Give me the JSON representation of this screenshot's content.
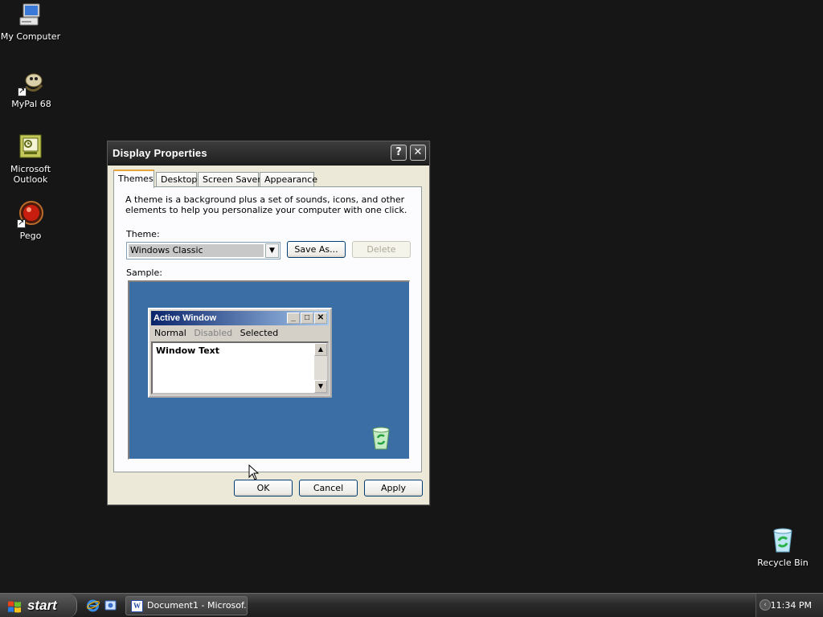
{
  "desktop": {
    "icons": [
      {
        "label": "My Computer"
      },
      {
        "label": "MyPal 68"
      },
      {
        "label": "Microsoft Outlook"
      },
      {
        "label": "Pego"
      },
      {
        "label": "Recycle Bin"
      }
    ]
  },
  "dialog": {
    "title": "Display Properties",
    "help_label": "?",
    "close_label": "✕",
    "tabs": [
      {
        "label": "Themes",
        "active": true
      },
      {
        "label": "Desktop"
      },
      {
        "label": "Screen Saver"
      },
      {
        "label": "Appearance"
      }
    ],
    "description": "A theme is a background plus a set of sounds, icons, and other elements to help you personalize your computer with one click.",
    "theme_label": "Theme:",
    "theme_value": "Windows Classic",
    "save_as_label": "Save As...",
    "delete_label": "Delete",
    "sample_label": "Sample:",
    "sample": {
      "window_title": "Active Window",
      "menu_normal": "Normal",
      "menu_disabled": "Disabled",
      "menu_selected": "Selected",
      "window_text": "Window Text"
    },
    "ok_label": "OK",
    "cancel_label": "Cancel",
    "apply_label": "Apply"
  },
  "taskbar": {
    "start_label": "start",
    "task_label": "Document1 - Microsof...",
    "clock": "11:34 PM"
  }
}
